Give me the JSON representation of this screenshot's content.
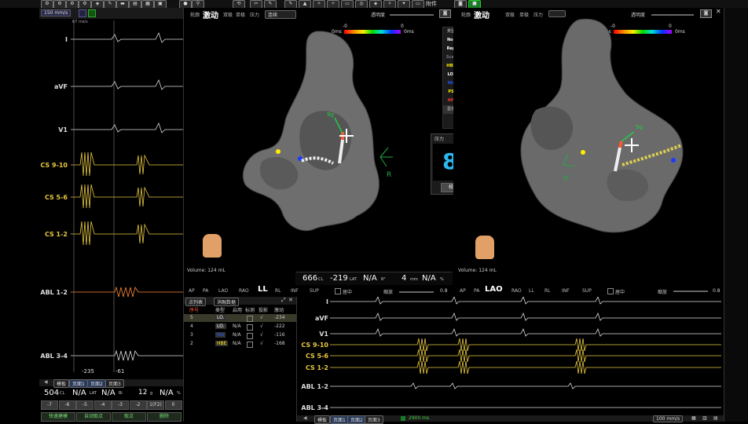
{
  "top_toolbar": {
    "attach_label": "附件"
  },
  "ecg_panel": {
    "speed": "150 mm/s",
    "scale_top": "67 ms/s",
    "leads": [
      {
        "name": "I",
        "color": "#dddddd"
      },
      {
        "name": "aVF",
        "color": "#dddddd"
      },
      {
        "name": "V1",
        "color": "#dddddd"
      },
      {
        "name": "CS 9-10",
        "color": "#e8c840"
      },
      {
        "name": "CS 5-6",
        "color": "#e8c840"
      },
      {
        "name": "CS 1-2",
        "color": "#e8c840"
      },
      {
        "name": "ABL 1-2",
        "color": "#dddddd"
      },
      {
        "name": "ABL 3-4",
        "color": "#dddddd"
      }
    ],
    "cursor_left_value": "-235",
    "cursor_right_value": "-61",
    "tabs": [
      "模板",
      "页面1",
      "页面2",
      "页面3"
    ],
    "stats": {
      "cl": "504",
      "cl_unit": "CL",
      "lat": "N/A",
      "lat_unit": "LAT",
      "bi": "N/A",
      "bi_unit": "Bi",
      "val12": "12",
      "g": "g",
      "na": "N/A",
      "pct": "%"
    },
    "num_buttons": [
      "-7",
      "-6",
      "-5",
      "-4",
      "-3",
      "-2",
      "1(F2)",
      "0"
    ],
    "action_buttons": [
      "快速建模",
      "自动取点",
      "取点",
      "删除"
    ]
  },
  "map_left": {
    "header_tabs": [
      "轮廓",
      "激动",
      "双极",
      "单极",
      "压力"
    ],
    "active_tab": "激动",
    "mode_select": "连续",
    "transparency_label": "透明度",
    "scale_left": "0ms",
    "scale_right": "0ms",
    "scale_top_left": "-0",
    "scale_top_right": "0",
    "volume": "Volume: 124 mL",
    "view_tabs": [
      "AP",
      "PA",
      "LAO",
      "RAO",
      "LL",
      "RL",
      "INF",
      "SUP"
    ],
    "active_view": "LL",
    "center_label": "居中",
    "zoom_label": "缩放",
    "zoom_value": "0.8",
    "orient_label": "R",
    "force_label": "9g"
  },
  "map_right": {
    "header_tabs": [
      "轮廓",
      "激动",
      "双极",
      "单极",
      "压力"
    ],
    "active_tab": "激动",
    "transparency_label": "透明度",
    "scale_left": "0ms",
    "scale_right": "0ms",
    "scale_top_left": "-0",
    "scale_top_right": "0",
    "volume": "Volume: 124 mL",
    "view_tabs": [
      "AP",
      "PA",
      "LAO",
      "RAO",
      "LL",
      "RL",
      "INF",
      "SUP"
    ],
    "active_view": "LAO",
    "center_label": "居中",
    "zoom_label": "缩放",
    "zoom_value": "0.8",
    "orient_label": "R",
    "force_label": "9g"
  },
  "type_legend": {
    "title": "类型",
    "items": [
      {
        "label": "Nor",
        "color": "#ffffff"
      },
      {
        "label": "Rep",
        "color": "#ffffff"
      },
      {
        "label": "Scar",
        "color": "#777777"
      },
      {
        "label": "HBE",
        "color": "#ffee00"
      },
      {
        "label": "LO.",
        "color": "#ffffff"
      },
      {
        "label": "His",
        "color": "#2255ff"
      },
      {
        "label": "PS",
        "color": "#ffee00"
      },
      {
        "label": "AM",
        "color": "#ff3333"
      }
    ],
    "footer": "显示"
  },
  "force_panel": {
    "title": "压力",
    "value": "8",
    "unit": "g",
    "button": "校零"
  },
  "map_stats": {
    "cl": "666",
    "cl_unit": "CL",
    "lat": "-219",
    "lat_unit": "LAT",
    "na1": "N/A",
    "r2": "R²",
    "mm": "4",
    "mm_unit": "mm",
    "na2": "N/A",
    "pct": "%"
  },
  "point_list": {
    "tabs": [
      "点列表",
      "消融数据"
    ],
    "headers": [
      "序号",
      "类型",
      "启用",
      "标测",
      "投影",
      "激动"
    ],
    "rows": [
      {
        "id": "5",
        "type": "LO.",
        "type_color": "#ffffff",
        "enabled": "",
        "map": "",
        "proj": "√",
        "act": "-234"
      },
      {
        "id": "4",
        "type": "LO.",
        "type_color": "#ffffff",
        "enabled": "N/A",
        "map": "",
        "proj": "√",
        "act": "-222"
      },
      {
        "id": "3",
        "type": "His",
        "type_color": "#2255ff",
        "enabled": "N/A",
        "map": "",
        "proj": "√",
        "act": "-116"
      },
      {
        "id": "2",
        "type": "HBE",
        "type_color": "#ffee00",
        "enabled": "N/A",
        "map": "",
        "proj": "√",
        "act": "-168"
      }
    ]
  },
  "lower_ecg": {
    "leads": [
      {
        "name": "I",
        "color": "#dddddd"
      },
      {
        "name": "aVF",
        "color": "#dddddd"
      },
      {
        "name": "V1",
        "color": "#dddddd"
      },
      {
        "name": "CS 9-10",
        "color": "#e8c840"
      },
      {
        "name": "CS 5-6",
        "color": "#e8c840"
      },
      {
        "name": "CS 1-2",
        "color": "#e8c840"
      },
      {
        "name": "ABL 1-2",
        "color": "#dddddd"
      },
      {
        "name": "ABL 3-4",
        "color": "#dddddd"
      }
    ],
    "tabs": [
      "模板",
      "页面1",
      "页面2",
      "页面3"
    ],
    "duration": "2900 ms",
    "speed": "100 mm/s"
  }
}
